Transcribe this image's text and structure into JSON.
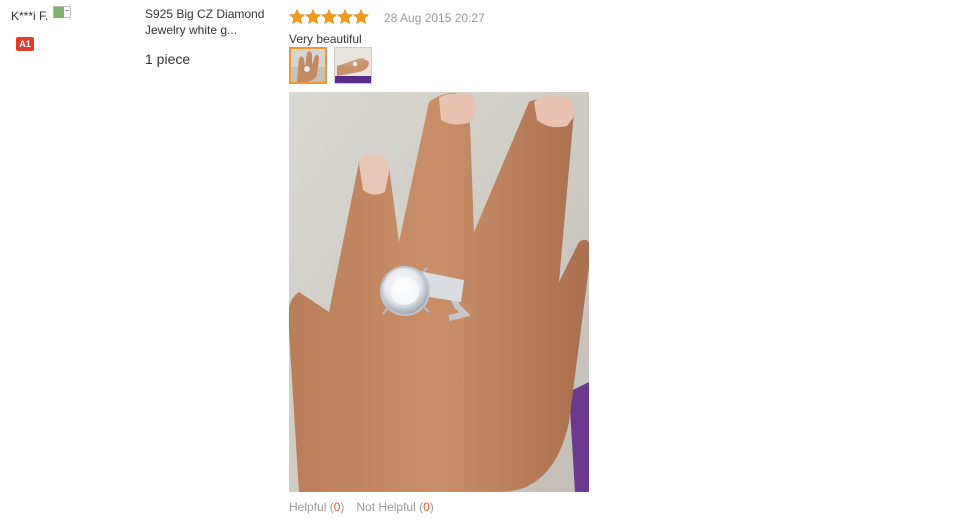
{
  "buyer": {
    "name": "K***i F.",
    "level": "A1",
    "flag_icon": "country-flag-icon"
  },
  "product": {
    "name_line1": "S925 Big CZ Diamond",
    "name_line2": "Jewelry white g...",
    "quantity": "1 piece"
  },
  "review": {
    "rating": 5,
    "rating_max": 5,
    "star_color": "#f39c12",
    "date": "28 Aug 2015 20:27",
    "text": "Very beautiful",
    "thumbnails": [
      "ring-hand-photo",
      "ring-hand-photo-2"
    ],
    "selected_thumbnail": 0
  },
  "feedback": {
    "helpful_label": "Helpful",
    "helpful_count": "0",
    "not_helpful_label": "Not Helpful",
    "not_helpful_count": "0"
  },
  "colors": {
    "badge": "#e23b2a",
    "count": "#e5542e",
    "thumb_selected": "#f0962a"
  }
}
